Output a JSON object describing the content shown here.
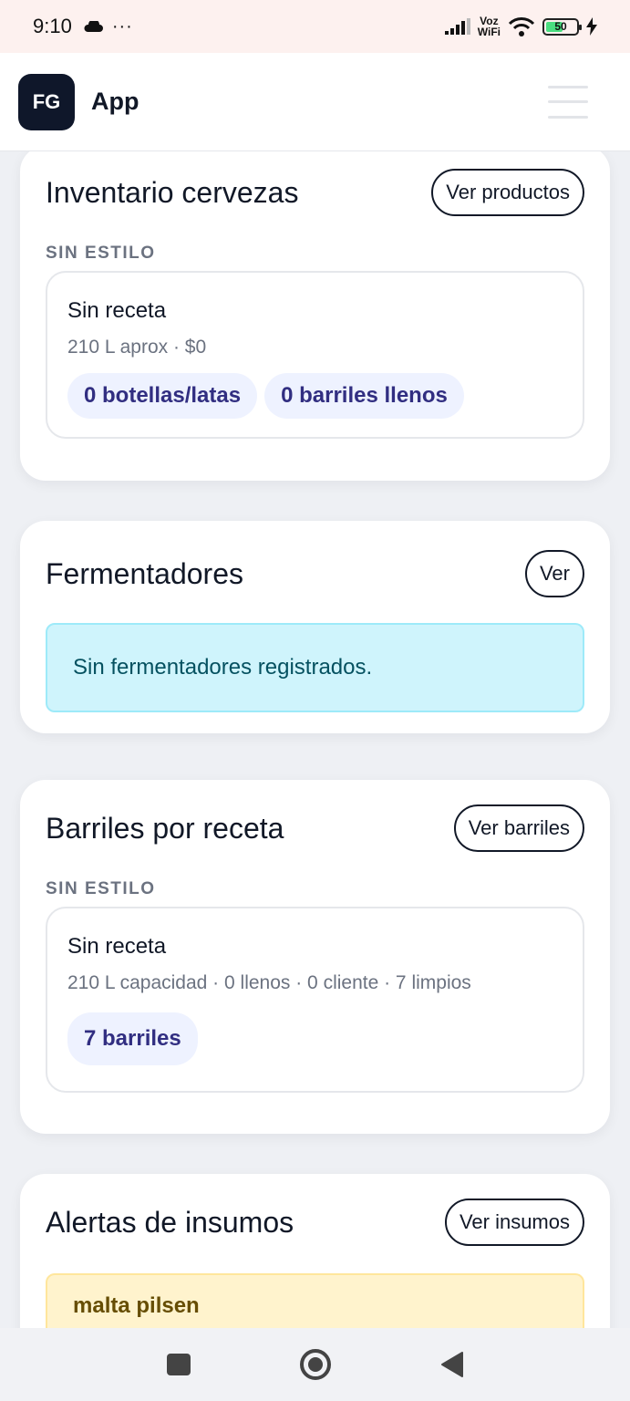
{
  "status": {
    "time": "9:10",
    "dots": "···",
    "voz": "Voz",
    "wifi_label": "WiFi",
    "battery": "50"
  },
  "header": {
    "logo": "FG",
    "app_name": "App"
  },
  "inventario": {
    "title": "Inventario cervezas",
    "button": "Ver productos",
    "section": "SIN ESTILO",
    "item_title": "Sin receta",
    "item_meta": "210 L aprox · $0",
    "pills": [
      "0 botellas/latas",
      "0 barriles llenos"
    ]
  },
  "fermentadores": {
    "title": "Fermentadores",
    "button": "Ver",
    "empty": "Sin fermentadores registrados."
  },
  "barriles": {
    "title": "Barriles por receta",
    "button": "Ver barriles",
    "section": "SIN ESTILO",
    "item_title": "Sin receta",
    "item_meta": "210 L capacidad · 0 llenos · 0 cliente · 7 limpios",
    "pills": [
      "7 barriles"
    ]
  },
  "alertas": {
    "title": "Alertas de insumos",
    "button": "Ver insumos",
    "first_alert": "malta pilsen"
  },
  "icons": {
    "cloud": "cloud-icon",
    "signal": "signal-icon",
    "wifi": "wifi-icon",
    "battery": "battery-icon",
    "charging": "charging-icon",
    "menu": "hamburger-menu-icon",
    "nav_recent": "recent-apps-icon",
    "nav_home": "home-icon",
    "nav_back": "back-icon"
  },
  "colors": {
    "brand_dark": "#0f172a",
    "pill_bg": "#eef2ff",
    "pill_text": "#312e81",
    "info_bg": "#cff4fc",
    "warn_bg": "#fff3cd"
  }
}
